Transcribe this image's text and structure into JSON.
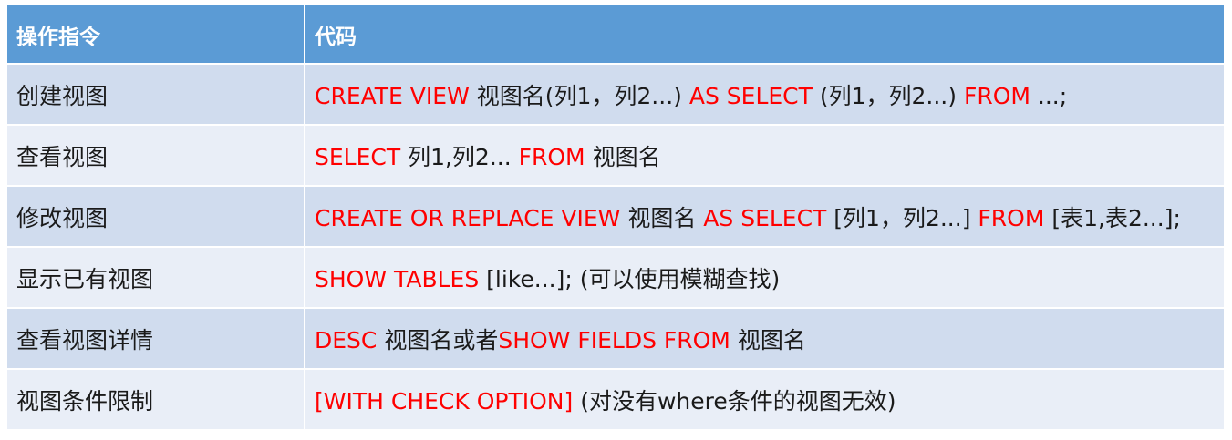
{
  "header": {
    "col_operation": "操作指令",
    "col_code": "代码"
  },
  "rows": [
    {
      "op": "创建视图",
      "code": [
        {
          "t": "CREATE VIEW",
          "kw": true
        },
        {
          "t": " 视图名(列1，列2...) ",
          "kw": false
        },
        {
          "t": "AS SELECT",
          "kw": true
        },
        {
          "t": " (列1，列2...) ",
          "kw": false
        },
        {
          "t": "FROM",
          "kw": true
        },
        {
          "t": " ...;",
          "kw": false
        }
      ]
    },
    {
      "op": "查看视图",
      "code": [
        {
          "t": "SELECT",
          "kw": true
        },
        {
          "t": " 列1,列2... ",
          "kw": false
        },
        {
          "t": "FROM",
          "kw": true
        },
        {
          "t": " 视图名",
          "kw": false
        }
      ]
    },
    {
      "op": "修改视图",
      "code": [
        {
          "t": "CREATE OR REPLACE VIEW",
          "kw": true
        },
        {
          "t": " 视图名 ",
          "kw": false
        },
        {
          "t": "AS SELECT",
          "kw": true
        },
        {
          "t": " [列1，列2...] ",
          "kw": false
        },
        {
          "t": "FROM",
          "kw": true
        },
        {
          "t": " [表1,表2...];",
          "kw": false
        }
      ]
    },
    {
      "op": "显示已有视图",
      "code": [
        {
          "t": "SHOW TABLES",
          "kw": true
        },
        {
          "t": " [like...]; (可以使用模糊查找)",
          "kw": false
        }
      ]
    },
    {
      "op": "查看视图详情",
      "code": [
        {
          "t": "DESC",
          "kw": true
        },
        {
          "t": " 视图名或者",
          "kw": false
        },
        {
          "t": "SHOW FIELDS FROM",
          "kw": true
        },
        {
          "t": " 视图名",
          "kw": false
        }
      ]
    },
    {
      "op": "视图条件限制",
      "code": [
        {
          "t": "[WITH CHECK OPTION]",
          "kw": true
        },
        {
          "t": " (对没有where条件的视图无效)",
          "kw": false
        }
      ]
    }
  ],
  "colors": {
    "header_bg": "#5b9bd5",
    "row_dark": "#d0dcee",
    "row_light": "#e9eef7",
    "keyword": "#ff0000"
  }
}
